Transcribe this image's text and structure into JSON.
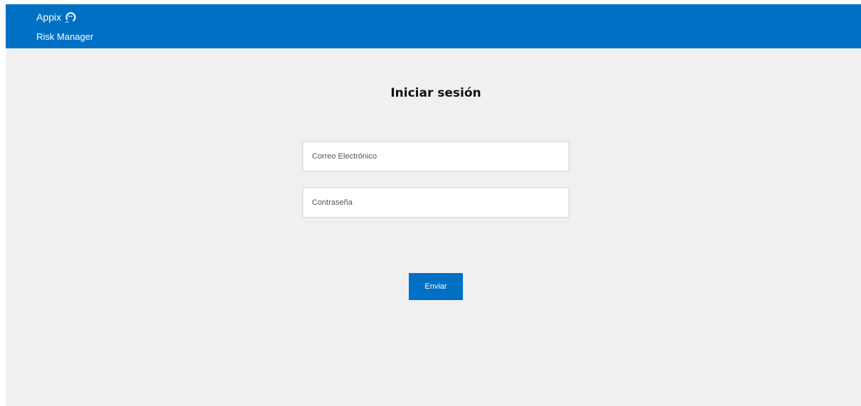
{
  "header": {
    "brand": "Appix",
    "brand_icon": "appix-logo-icon",
    "app_name": "Risk Manager"
  },
  "login": {
    "title": "Iniciar sesión",
    "email_placeholder": "Correo Electrónico",
    "email_value": "",
    "password_placeholder": "Contraseña",
    "password_value": "",
    "submit_label": "Enviar"
  },
  "colors": {
    "primary": "#0070c5",
    "background": "#f0f0f0",
    "field_border": "#e2e2e2"
  }
}
